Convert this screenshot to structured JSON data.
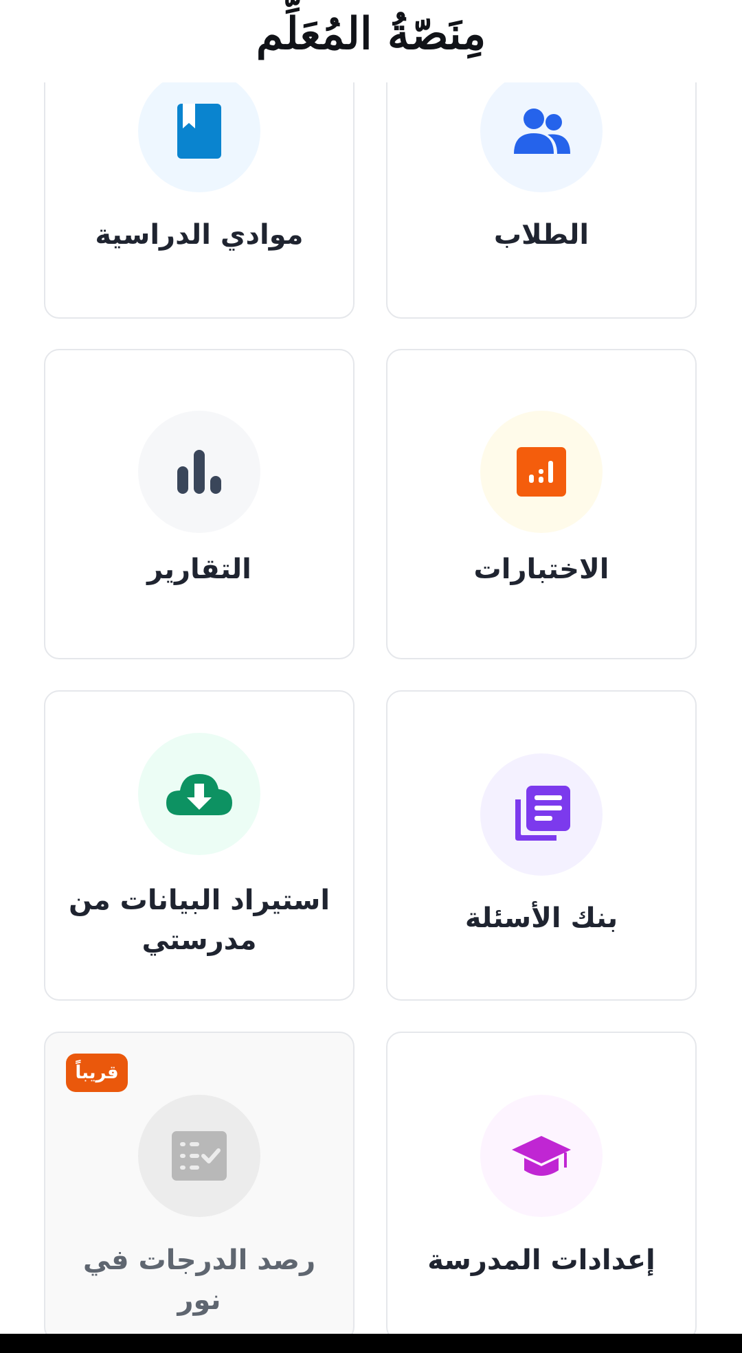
{
  "header": {
    "logo_text": "مِنَصّةُ المُعَلِّم"
  },
  "cards": [
    {
      "label": "الطلاب",
      "icon": "users-icon",
      "icon_color": "#2563eb",
      "bg_color": "#eff6ff"
    },
    {
      "label": "موادي الدراسية",
      "icon": "book-icon",
      "icon_color": "#0a84cf",
      "bg_color": "#eef7ff"
    },
    {
      "label": "الاختبارات",
      "icon": "exam-chart-icon",
      "icon_color": "#f45d0c",
      "bg_color": "#fffbea"
    },
    {
      "label": "التقارير",
      "icon": "bar-chart-icon",
      "icon_color": "#3a465a",
      "bg_color": "#f6f7f9"
    },
    {
      "label": "بنك الأسئلة",
      "icon": "question-bank-icon",
      "icon_color": "#7c3aed",
      "bg_color": "#f4f1ff"
    },
    {
      "label": "استيراد البيانات من مدرستي",
      "icon": "cloud-download-icon",
      "icon_color": "#0d9262",
      "bg_color": "#ecfdf5"
    },
    {
      "label": "إعدادات المدرسة",
      "icon": "graduation-cap-icon",
      "icon_color": "#c026d3",
      "bg_color": "#fdf4ff"
    },
    {
      "label": "رصد الدرجات في نور",
      "icon": "grades-check-icon",
      "icon_color": "#b8b8b8",
      "bg_color": "#ececec",
      "badge": "قريباً",
      "badge_color": "#ea580c"
    }
  ]
}
